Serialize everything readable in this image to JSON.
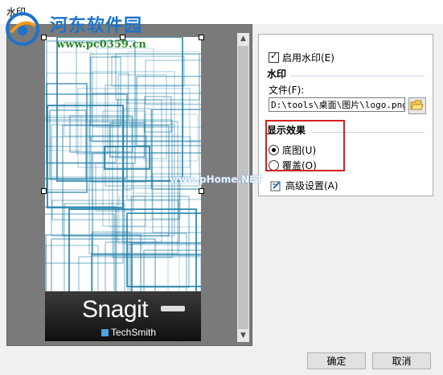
{
  "window": {
    "title": "水印"
  },
  "watermark_overlay": {
    "site_name": "河东软件园",
    "site_url": "www.pc0359.cn",
    "mid_text": "www.pHome.NET"
  },
  "preview": {
    "snagit_logo_text": "Snagit",
    "techsmith_text": "TechSmith"
  },
  "options": {
    "enable_label": "启用水印(E)",
    "enable_checked": true,
    "section_watermark": "水印",
    "file_label": "文件(F):",
    "file_value": "D:\\tools\\桌面\\图片\\logo.png",
    "section_effect": "显示效果",
    "radio_underlay": "底图(U)",
    "radio_overlay": "覆盖(O)",
    "selected": "底图(U)",
    "advanced_label": "高级设置(A)"
  },
  "buttons": {
    "ok": "确定",
    "cancel": "取消"
  },
  "colors": {
    "highlight_box": "#d42020",
    "pattern_lines": "#1f7ea6"
  }
}
